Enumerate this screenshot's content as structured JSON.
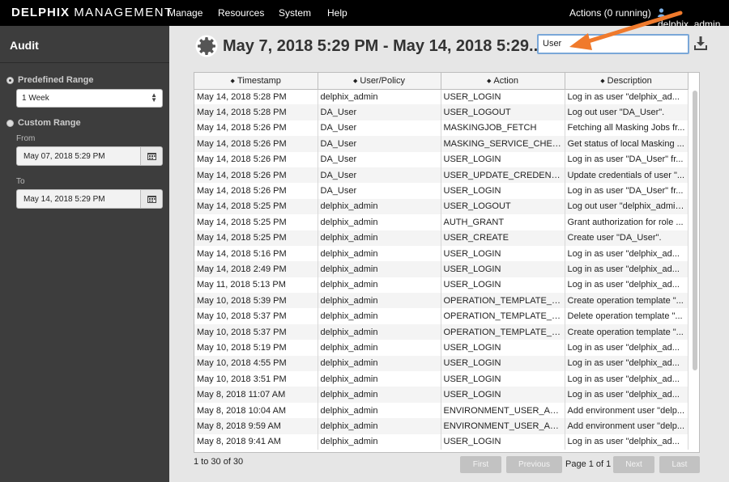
{
  "app": {
    "brand_bold": "DELPHIX",
    "brand_light": "MANAGEMENT",
    "nav": [
      "Manage",
      "Resources",
      "System",
      "Help"
    ],
    "actions": "Actions (0 running)",
    "user": "delphix_admin"
  },
  "sidebar": {
    "title": "Audit",
    "predefined_label": "Predefined Range",
    "predefined_value": "1 Week",
    "custom_label": "Custom Range",
    "from_label": "From",
    "from_value": "May 07, 2018 5:29 PM",
    "to_label": "To",
    "to_value": "May 14, 2018 5:29 PM"
  },
  "header": {
    "range_title": "May 7, 2018 5:29 PM - May 14, 2018 5:29...",
    "search_value": "User"
  },
  "table": {
    "columns": [
      "Timestamp",
      "User/Policy",
      "Action",
      "Description"
    ],
    "rows": [
      [
        "May 14, 2018 5:28 PM",
        "delphix_admin",
        "USER_LOGIN",
        "Log in as user \"delphix_ad..."
      ],
      [
        "May 14, 2018 5:28 PM",
        "DA_User",
        "USER_LOGOUT",
        "Log out user \"DA_User\"."
      ],
      [
        "May 14, 2018 5:26 PM",
        "DA_User",
        "MASKINGJOB_FETCH",
        "Fetching all Masking Jobs fr..."
      ],
      [
        "May 14, 2018 5:26 PM",
        "DA_User",
        "MASKING_SERVICE_CHEC...",
        "Get status of local Masking ..."
      ],
      [
        "May 14, 2018 5:26 PM",
        "DA_User",
        "USER_LOGIN",
        "Log in as user \"DA_User\" fr..."
      ],
      [
        "May 14, 2018 5:26 PM",
        "DA_User",
        "USER_UPDATE_CREDENTI...",
        "Update credentials of user \"..."
      ],
      [
        "May 14, 2018 5:26 PM",
        "DA_User",
        "USER_LOGIN",
        "Log in as user \"DA_User\" fr..."
      ],
      [
        "May 14, 2018 5:25 PM",
        "delphix_admin",
        "USER_LOGOUT",
        "Log out user \"delphix_admin\"."
      ],
      [
        "May 14, 2018 5:25 PM",
        "delphix_admin",
        "AUTH_GRANT",
        "Grant authorization for role ..."
      ],
      [
        "May 14, 2018 5:25 PM",
        "delphix_admin",
        "USER_CREATE",
        "Create user \"DA_User\"."
      ],
      [
        "May 14, 2018 5:16 PM",
        "delphix_admin",
        "USER_LOGIN",
        "Log in as user \"delphix_ad..."
      ],
      [
        "May 14, 2018 2:49 PM",
        "delphix_admin",
        "USER_LOGIN",
        "Log in as user \"delphix_ad..."
      ],
      [
        "May 11, 2018 5:13 PM",
        "delphix_admin",
        "USER_LOGIN",
        "Log in as user \"delphix_ad..."
      ],
      [
        "May 10, 2018 5:39 PM",
        "delphix_admin",
        "OPERATION_TEMPLATE_C...",
        "Create operation template \"..."
      ],
      [
        "May 10, 2018 5:37 PM",
        "delphix_admin",
        "OPERATION_TEMPLATE_D...",
        "Delete operation template \"..."
      ],
      [
        "May 10, 2018 5:37 PM",
        "delphix_admin",
        "OPERATION_TEMPLATE_C...",
        "Create operation template \"..."
      ],
      [
        "May 10, 2018 5:19 PM",
        "delphix_admin",
        "USER_LOGIN",
        "Log in as user \"delphix_ad..."
      ],
      [
        "May 10, 2018 4:55 PM",
        "delphix_admin",
        "USER_LOGIN",
        "Log in as user \"delphix_ad..."
      ],
      [
        "May 10, 2018 3:51 PM",
        "delphix_admin",
        "USER_LOGIN",
        "Log in as user \"delphix_ad..."
      ],
      [
        "May 8, 2018 11:07 AM",
        "delphix_admin",
        "USER_LOGIN",
        "Log in as user \"delphix_ad..."
      ],
      [
        "May 8, 2018 10:04 AM",
        "delphix_admin",
        "ENVIRONMENT_USER_ADD",
        "Add environment user \"delp..."
      ],
      [
        "May 8, 2018 9:59 AM",
        "delphix_admin",
        "ENVIRONMENT_USER_ADD",
        "Add environment user \"delp..."
      ],
      [
        "May 8, 2018 9:41 AM",
        "delphix_admin",
        "USER_LOGIN",
        "Log in as user \"delphix_ad..."
      ]
    ]
  },
  "footer": {
    "count": "1 to 30 of 30",
    "first": "First",
    "previous": "Previous",
    "page_of": "Page 1 of 1",
    "next": "Next",
    "last": "Last"
  },
  "colors": {
    "annotation_arrow": "#f07a2c",
    "topbar": "#000000",
    "sidebar": "#3d3d3d",
    "search_border": "#7aa7d8"
  }
}
